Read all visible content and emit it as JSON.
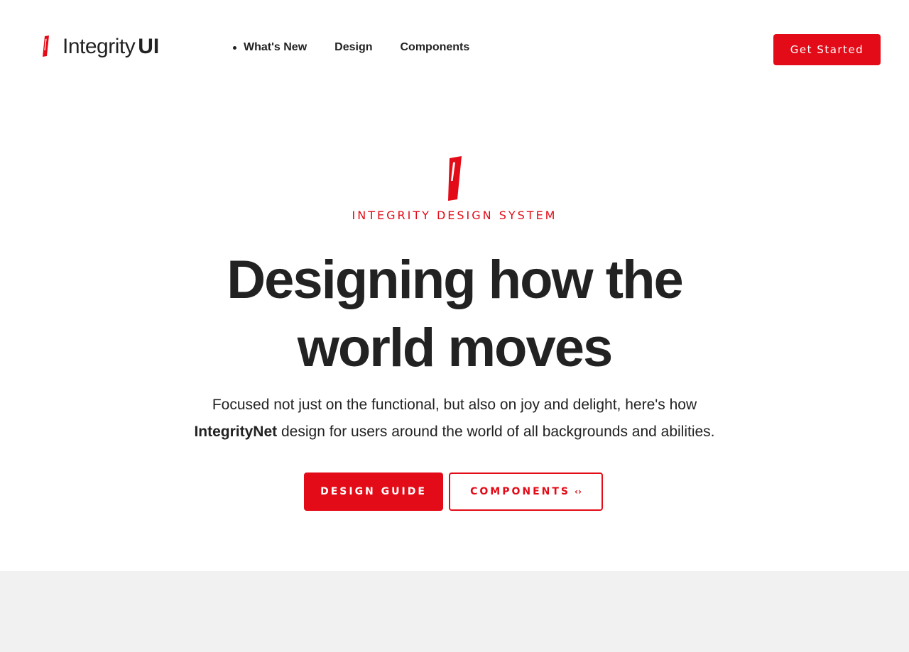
{
  "brand": {
    "name": "Integrity",
    "suffix": "UI",
    "icon": "integrity-brush-mark-icon",
    "color": "#e30b17"
  },
  "nav": {
    "items": [
      {
        "label": "What's New",
        "active": true
      },
      {
        "label": "Design"
      },
      {
        "label": "Components"
      }
    ]
  },
  "header": {
    "cta_label": "Get Started"
  },
  "hero": {
    "eyebrow": "INTEGRITY DESIGN SYSTEM",
    "headline_line1": "Designing how the",
    "headline_line2": "world moves",
    "lede_line1": "Focused not just on the functional, but also on joy and delight, here's how",
    "lede_bold": "IntegrityNet",
    "lede_line2": " design for users around the world of all backgrounds and abilities.",
    "primary_button": "DESIGN GUIDE",
    "secondary_button": "COMPONENTS",
    "secondary_icon": "code-brackets-icon",
    "secondary_icon_glyph": "‹›"
  },
  "colors": {
    "accent": "#e30b17",
    "text": "#222222",
    "band": "#f1f1f1"
  }
}
